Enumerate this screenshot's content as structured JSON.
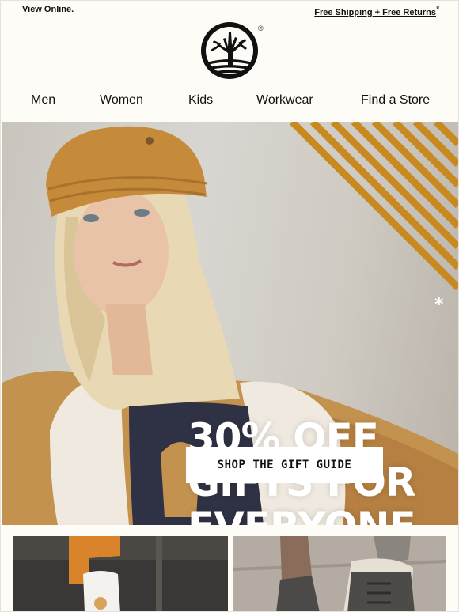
{
  "header": {
    "view_online": "View Online.",
    "shipping": "Free Shipping + Free Returns",
    "shipping_asterisk": "*",
    "registered_mark": "®",
    "logo_icon": "timberland-tree-logo"
  },
  "nav": {
    "items": [
      {
        "label": "Men"
      },
      {
        "label": "Women"
      },
      {
        "label": "Kids"
      },
      {
        "label": "Workwear"
      },
      {
        "label": "Find a Store"
      }
    ]
  },
  "hero": {
    "headline_line1": "30% OFF",
    "headline_asterisk": "*",
    "headline_line2": "GIFTS FOR",
    "headline_line3": "EVERYONE",
    "cta_label": "SHOP THE GIFT GUIDE",
    "stripe_color": "#c8891f",
    "beanie_color": "#c58b3a",
    "jacket_color": "#c4924f"
  },
  "tiles": [
    {
      "icon": "product-photo-socks"
    },
    {
      "icon": "product-photo-boots"
    }
  ]
}
